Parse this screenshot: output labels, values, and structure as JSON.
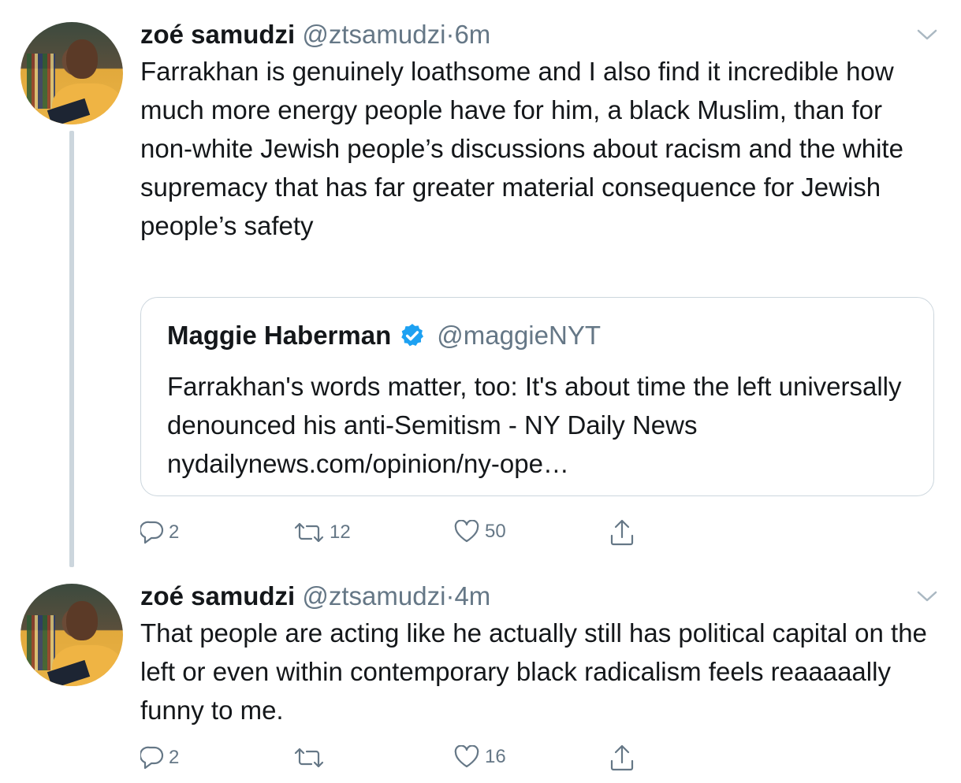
{
  "tweets": [
    {
      "name": "zoé samudzi",
      "handle": "@ztsamudzi",
      "separator": "·",
      "time": "6m",
      "text": "Farrakhan is genuinely loathsome and I also find it incredible how much more energy people have for him, a black Muslim, than for non-white Jewish people’s discussions about racism and the white supremacy that has far greater material consequence for Jewish people’s safety",
      "quote": {
        "name": "Maggie Haberman",
        "handle": "@maggieNYT",
        "text": "Farrakhan's words matter, too: It's about time the left universally denounced his anti-Semitism - NY Daily News nydailynews.com/opinion/ny-ope…"
      },
      "replies": "2",
      "retweets": "12",
      "likes": "50"
    },
    {
      "name": "zoé samudzi",
      "handle": "@ztsamudzi",
      "separator": "·",
      "time": "4m",
      "text": "That people are acting like he actually still has political capital on the left or even within contemporary black radicalism feels reaaaaally funny to me.",
      "replies": "2",
      "retweets": "",
      "likes": "16"
    }
  ],
  "colors": {
    "text": "#14171a",
    "secondary": "#657786",
    "border": "#ccd6dd",
    "verified": "#1da1f2"
  },
  "icons": [
    "reply-icon",
    "retweet-icon",
    "like-icon",
    "share-icon",
    "chevron-down-icon",
    "verified-badge-icon"
  ]
}
